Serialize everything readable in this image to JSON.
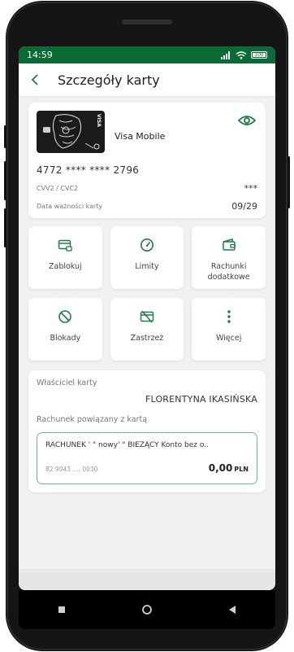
{
  "status_bar": {
    "time": "14:59",
    "battery": "100"
  },
  "header": {
    "title": "Szczegóły karty"
  },
  "card": {
    "name": "Visa Mobile",
    "brand": "VISA",
    "number": "4772 **** **** 2796",
    "cvv_label": "CVV2 / CVC2",
    "cvv_value": "***",
    "expiry_label": "Data ważności karty",
    "expiry_value": "09/29"
  },
  "tiles": [
    {
      "label": "Zablokuj",
      "icon": "card-lock-icon"
    },
    {
      "label": "Limity",
      "icon": "gauge-icon"
    },
    {
      "label": "Rachunki dodatkowe",
      "icon": "wallet-icon"
    },
    {
      "label": "Blokady",
      "icon": "block-icon"
    },
    {
      "label": "Zastrzeż",
      "icon": "card-cancel-icon"
    },
    {
      "label": "Więcej",
      "icon": "more-vertical-icon"
    }
  ],
  "owner": {
    "label": "Właściciel karty",
    "name": "FLORENTYNA IKASIŃSKA",
    "linked_label": "Rachunek powiązany z kartą"
  },
  "account": {
    "title": "RACHUNEK ' \" nowy' \" BIEŻĄCY Konto bez o..",
    "number": "82 9043 .... 0030",
    "balance": "0,00",
    "currency": "PLN"
  },
  "colors": {
    "brand_green": "#0b6b37",
    "accent_green": "#1f7a45"
  }
}
